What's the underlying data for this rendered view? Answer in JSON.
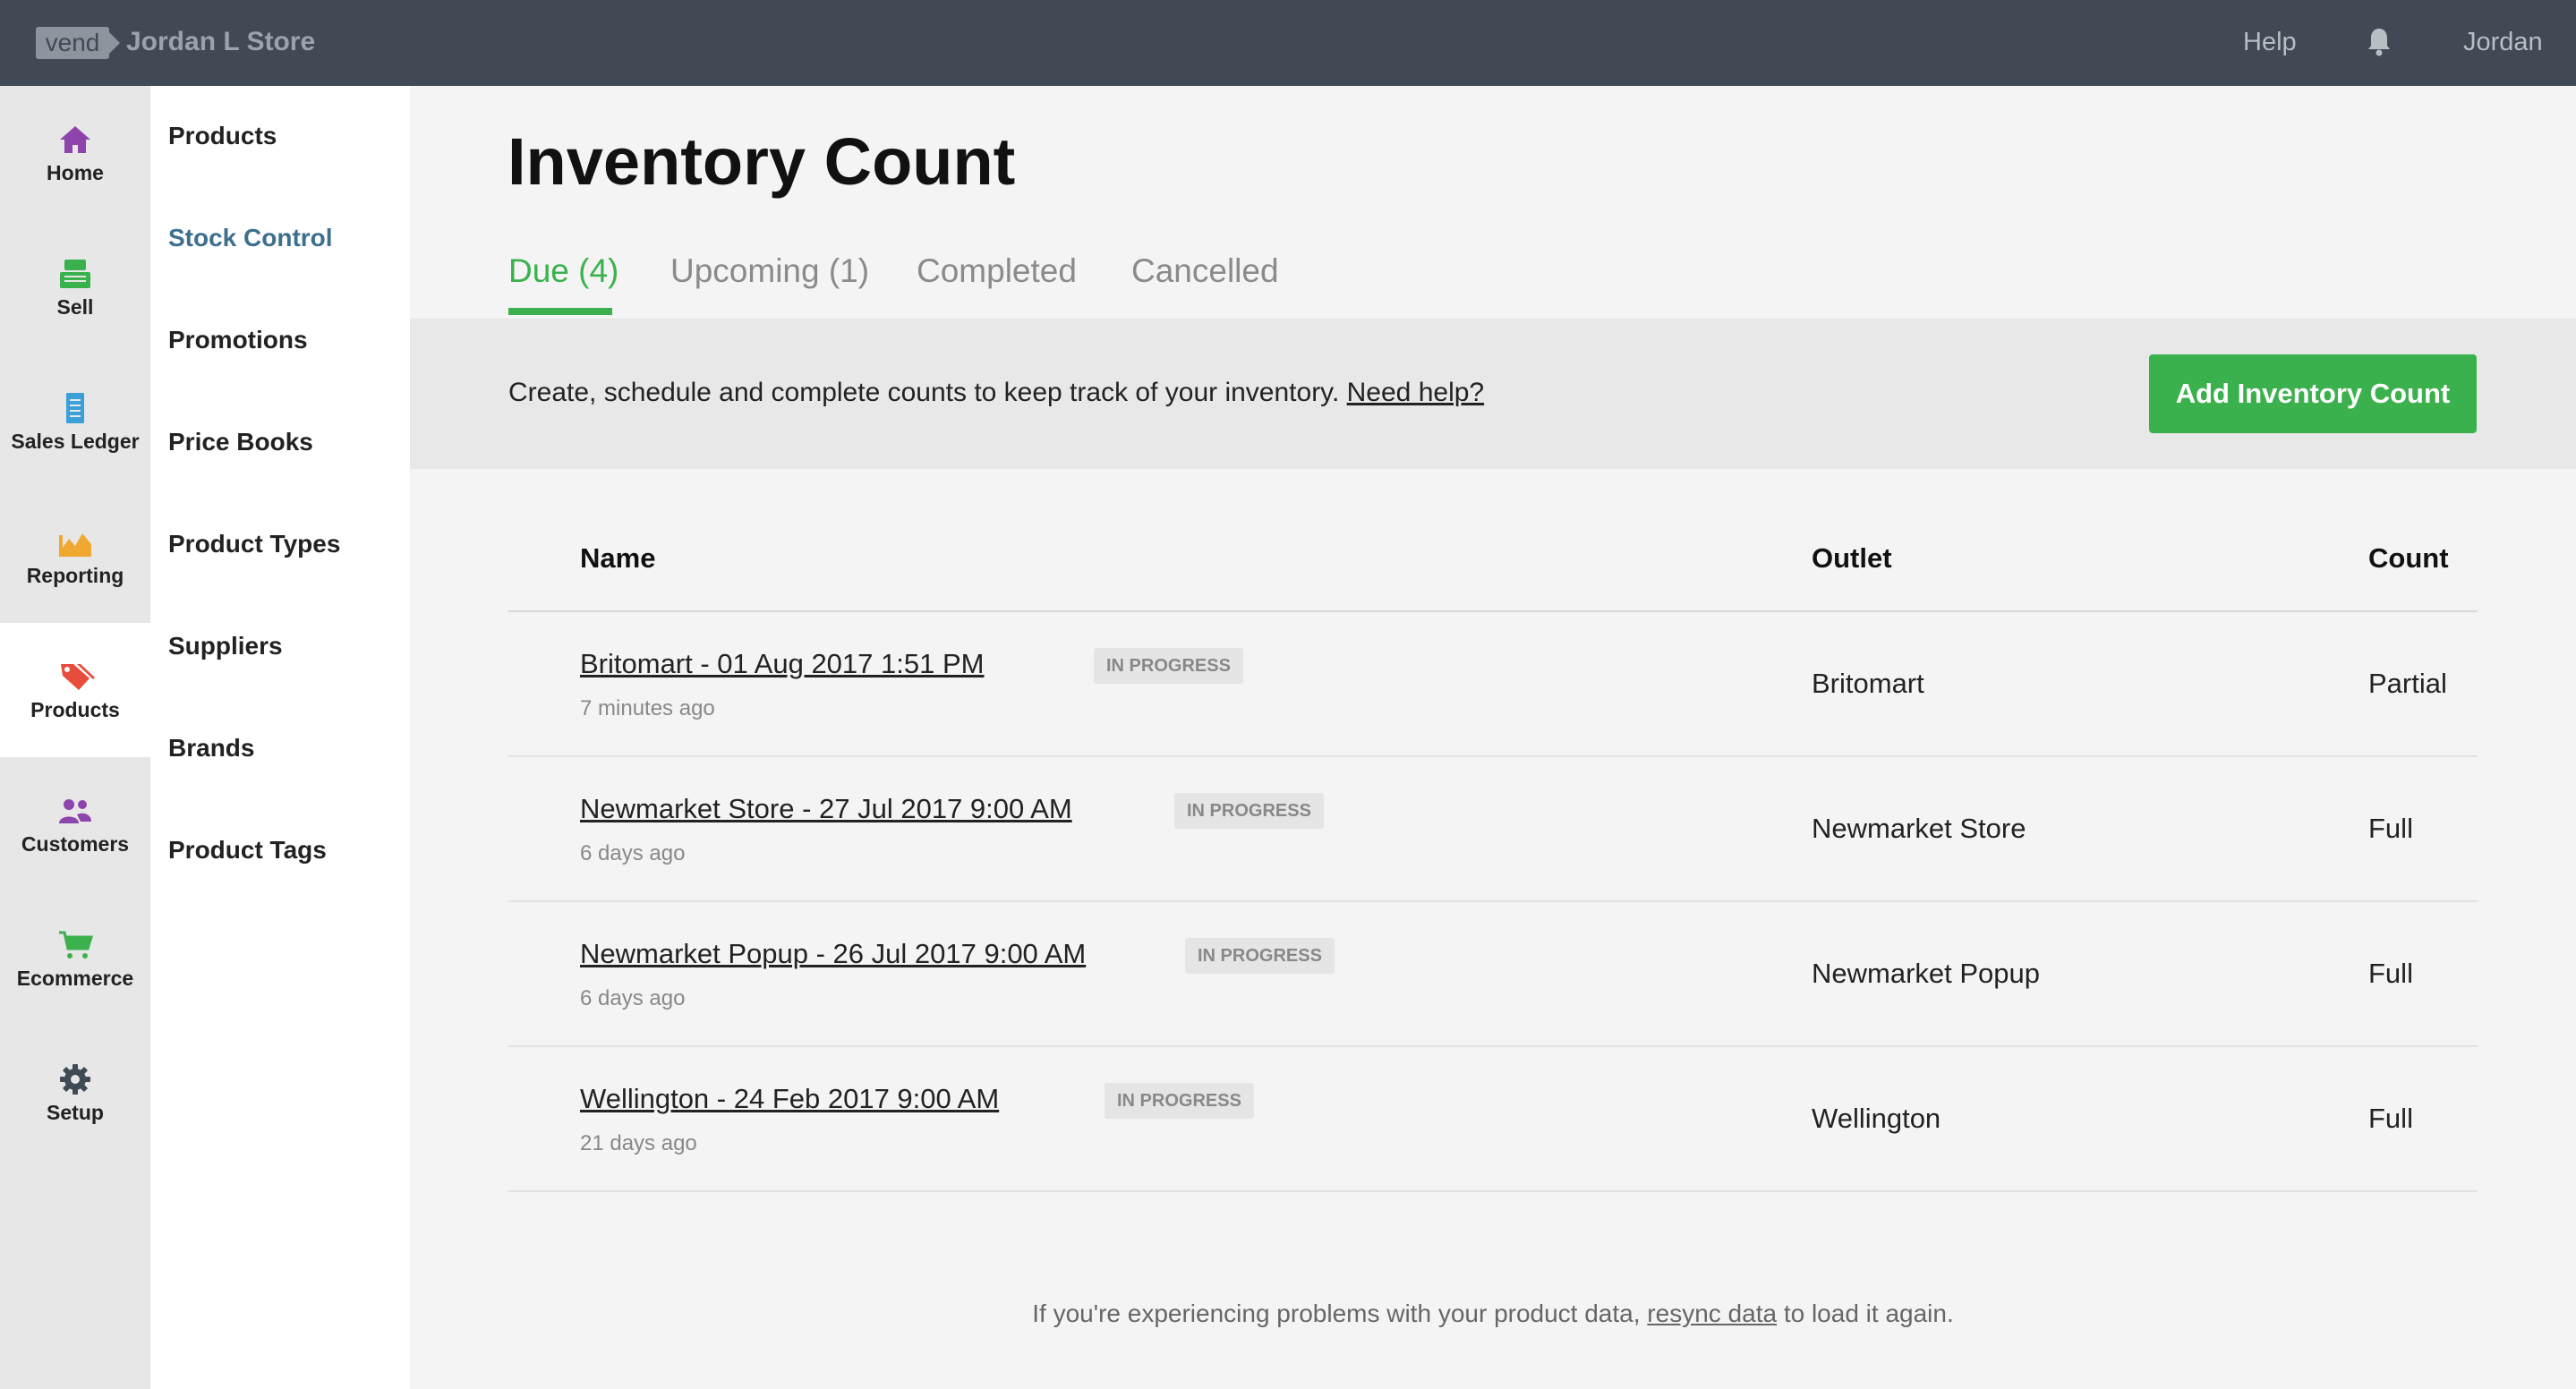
{
  "topbar": {
    "logo": "vend",
    "store_name": "Jordan L Store",
    "help": "Help",
    "user": "Jordan"
  },
  "rail": [
    {
      "label": "Home",
      "icon": "home-icon",
      "color": "#8e44ad"
    },
    {
      "label": "Sell",
      "icon": "register-icon",
      "color": "#3bb14d"
    },
    {
      "label": "Sales Ledger",
      "icon": "ledger-icon",
      "color": "#3aa0d8"
    },
    {
      "label": "Reporting",
      "icon": "chart-icon",
      "color": "#f0a830"
    },
    {
      "label": "Products",
      "icon": "tag-icon",
      "color": "#e74c3c"
    },
    {
      "label": "Customers",
      "icon": "users-icon",
      "color": "#8e44ad"
    },
    {
      "label": "Ecommerce",
      "icon": "cart-icon",
      "color": "#3bb14d"
    },
    {
      "label": "Setup",
      "icon": "gear-icon",
      "color": "#3f4a55"
    }
  ],
  "subnav": [
    {
      "label": "Products"
    },
    {
      "label": "Stock Control"
    },
    {
      "label": "Promotions"
    },
    {
      "label": "Price Books"
    },
    {
      "label": "Product Types"
    },
    {
      "label": "Suppliers"
    },
    {
      "label": "Brands"
    },
    {
      "label": "Product Tags"
    }
  ],
  "page": {
    "title": "Inventory Count",
    "tabs": [
      {
        "label": "Due (4)"
      },
      {
        "label": "Upcoming (1)"
      },
      {
        "label": "Completed"
      },
      {
        "label": "Cancelled"
      }
    ],
    "info_text": "Create, schedule and complete counts to keep track of your inventory.",
    "info_link": "Need help?",
    "add_button": "Add Inventory Count"
  },
  "table": {
    "headers": {
      "name": "Name",
      "outlet": "Outlet",
      "count": "Count"
    },
    "rows": [
      {
        "name": "Britomart - 01 Aug 2017 1:51 PM",
        "status": "IN PROGRESS",
        "time": "7 minutes ago",
        "outlet": "Britomart",
        "count": "Partial"
      },
      {
        "name": "Newmarket Store - 27 Jul 2017 9:00 AM",
        "status": "IN PROGRESS",
        "time": "6 days ago",
        "outlet": "Newmarket Store",
        "count": "Full"
      },
      {
        "name": "Newmarket Popup - 26 Jul 2017 9:00 AM",
        "status": "IN PROGRESS",
        "time": "6 days ago",
        "outlet": "Newmarket Popup",
        "count": "Full"
      },
      {
        "name": "Wellington - 24 Feb 2017 9:00 AM",
        "status": "IN PROGRESS",
        "time": "21 days ago",
        "outlet": "Wellington",
        "count": "Full"
      }
    ]
  },
  "footer": {
    "before": "If you're experiencing problems with your product data,",
    "link": "resync data",
    "after": "to load it again."
  }
}
